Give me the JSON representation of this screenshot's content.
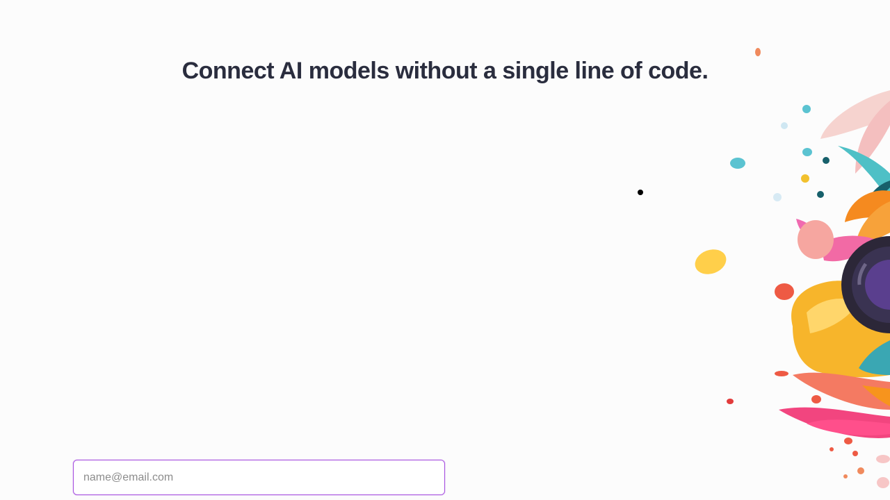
{
  "hero": {
    "headline": "Connect AI models without a single line of code."
  },
  "signup": {
    "email_placeholder": "name@email.com",
    "email_value": ""
  },
  "illustration": {
    "icon": "floral-illustration"
  },
  "colors": {
    "headline": "#2a2d3e",
    "input_border": "#a64fe0",
    "background": "#fcfcfc"
  }
}
